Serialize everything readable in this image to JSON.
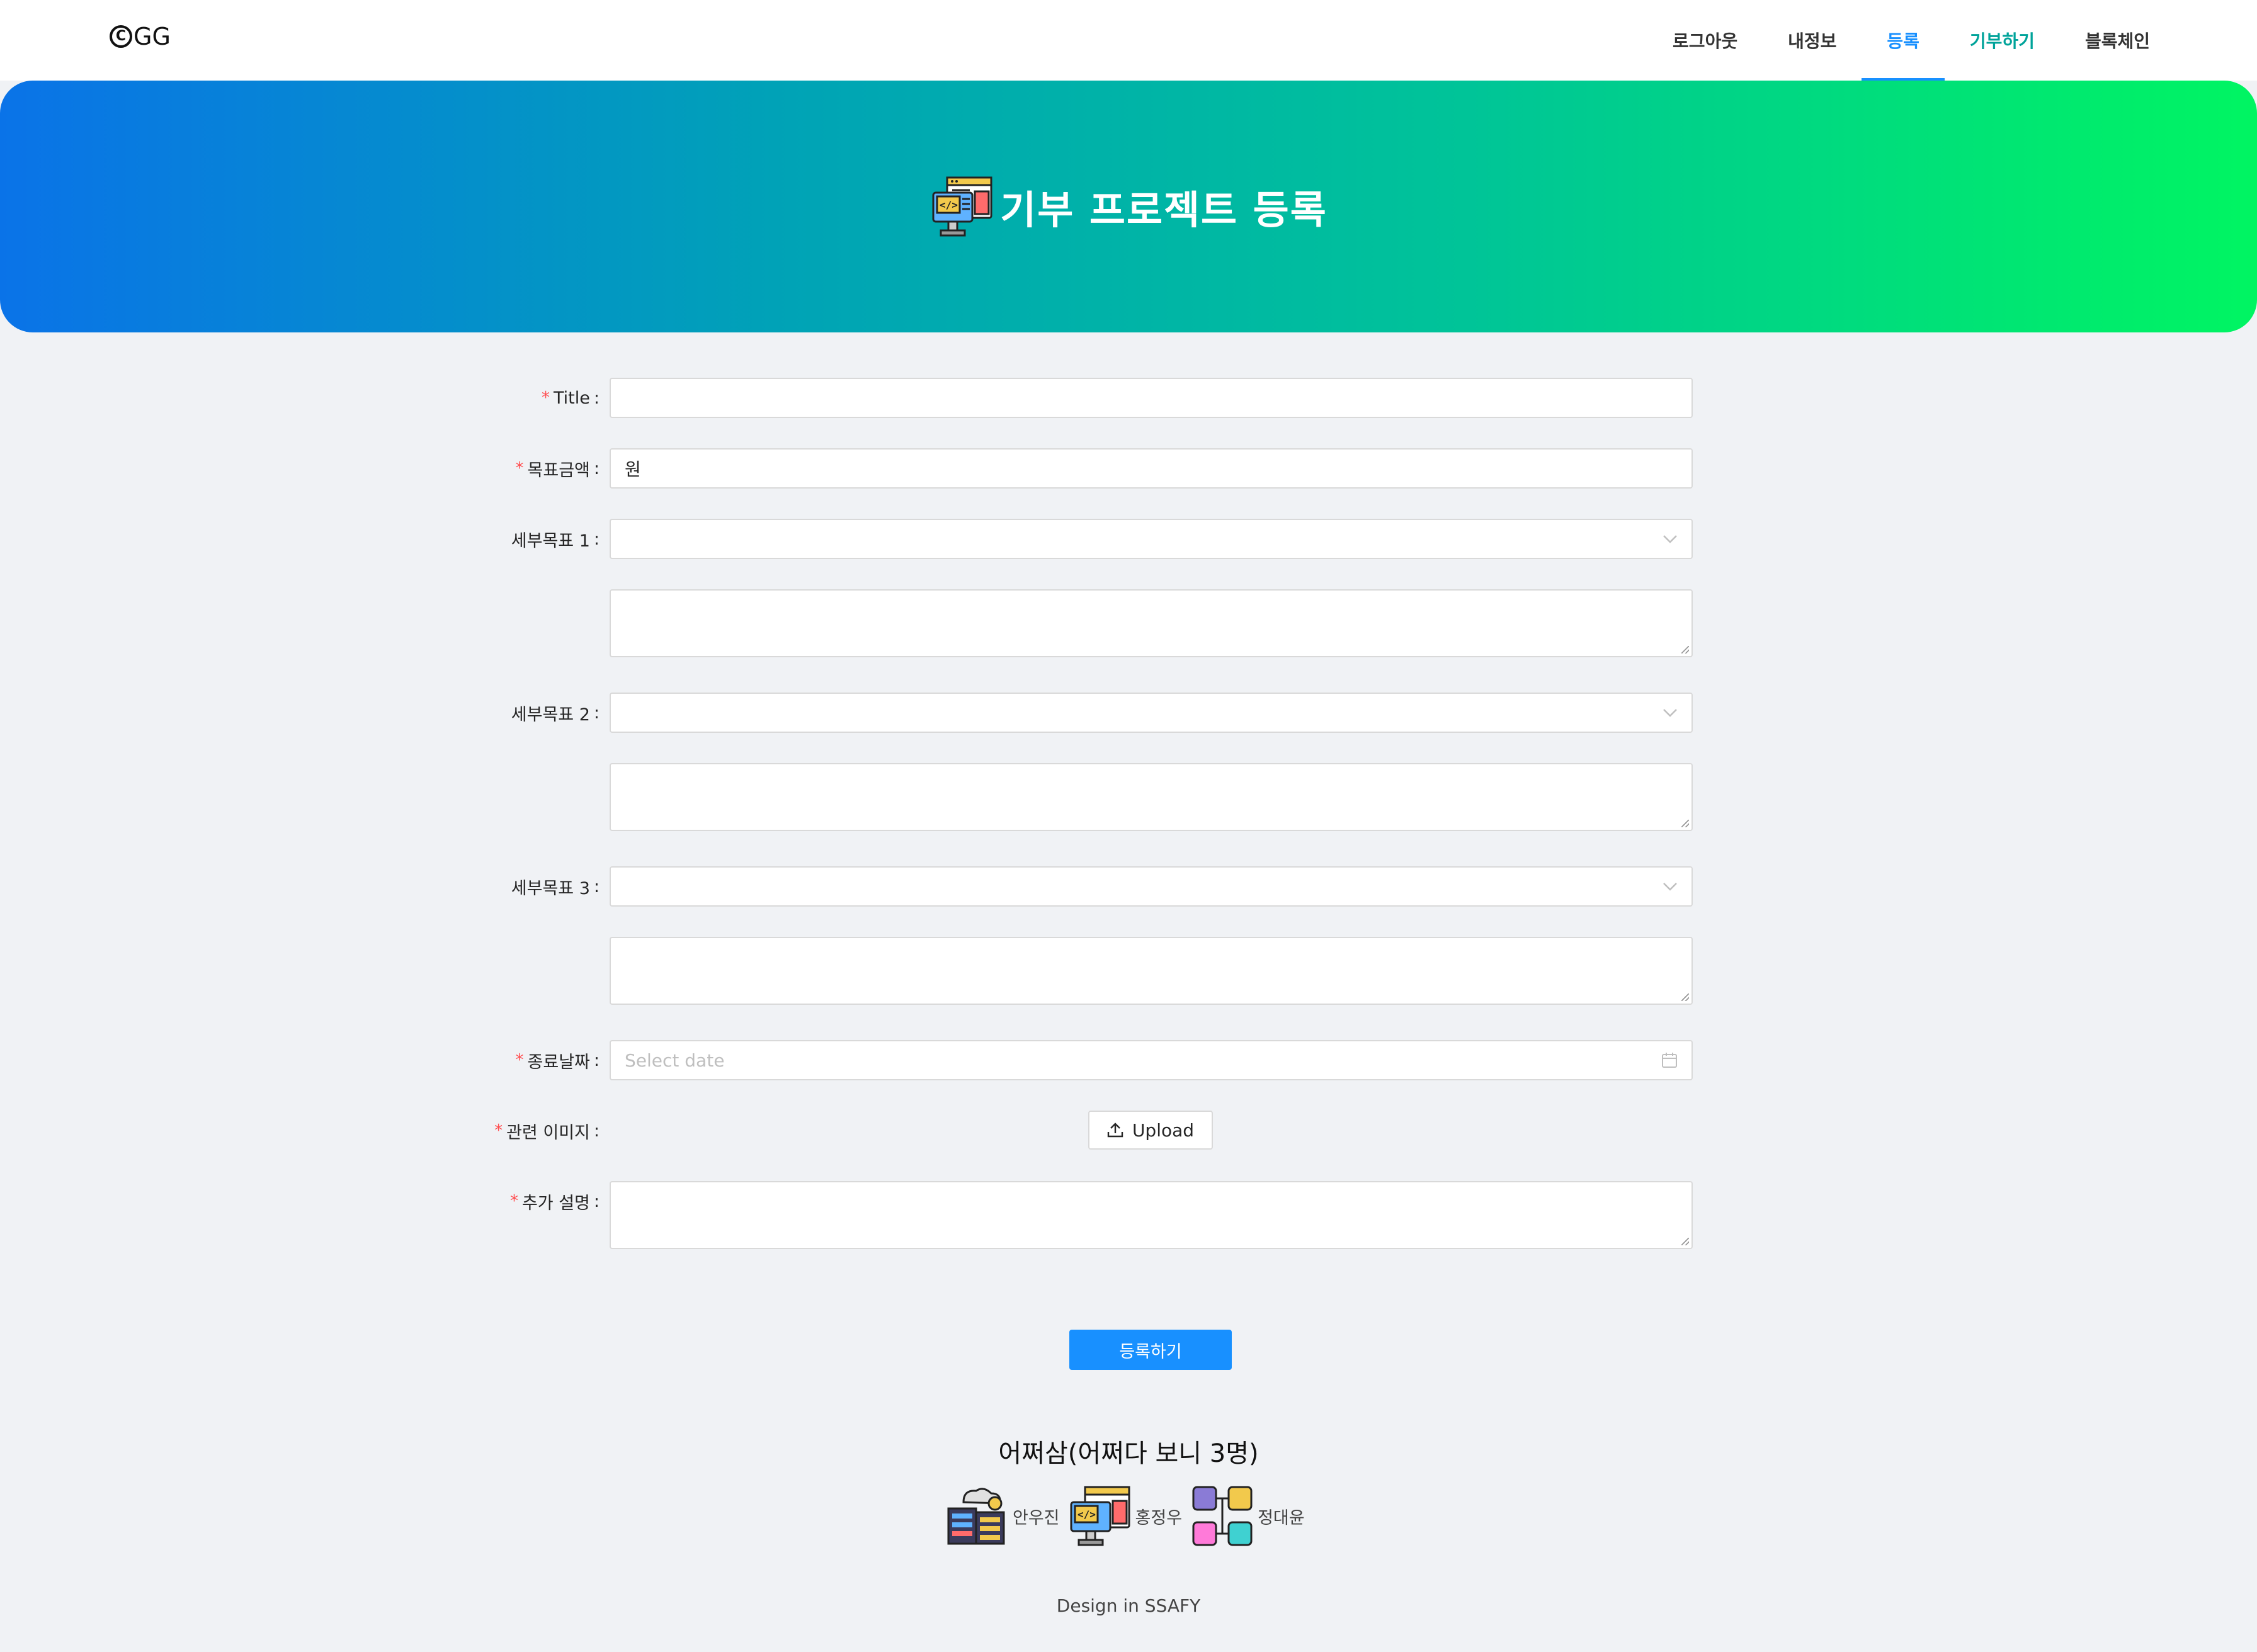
{
  "header": {
    "logo": "GG",
    "nav": [
      {
        "label": "로그아웃"
      },
      {
        "label": "내정보"
      },
      {
        "label": "등록"
      },
      {
        "label": "기부하기"
      },
      {
        "label": "블록체인"
      }
    ],
    "active_index": 2
  },
  "banner": {
    "title": "기부 프로젝트 등록",
    "icon": "code-monitor-icon"
  },
  "form": {
    "title": {
      "label": "Title",
      "required": true,
      "value": ""
    },
    "goal_amount": {
      "label": "목표금액",
      "required": true,
      "prefix": "원",
      "value": ""
    },
    "sub_goal_1": {
      "label": "세부목표 1",
      "required": false,
      "value": "",
      "description": ""
    },
    "sub_goal_2": {
      "label": "세부목표 2",
      "required": false,
      "value": "",
      "description": ""
    },
    "sub_goal_3": {
      "label": "세부목표 3",
      "required": false,
      "value": "",
      "description": ""
    },
    "end_date": {
      "label": "종료날짜",
      "required": true,
      "placeholder": "Select date"
    },
    "image": {
      "label": "관련 이미지",
      "required": true,
      "button": "Upload"
    },
    "extra_description": {
      "label": "추가 설명",
      "required": true,
      "value": ""
    },
    "submit": "등록하기"
  },
  "team": {
    "title": "어쩌삼(어쩌다 보니 3명)",
    "members": [
      {
        "name": "안우진",
        "icon": "cloud-server-icon"
      },
      {
        "name": "홍정우",
        "icon": "code-monitor-icon"
      },
      {
        "name": "정대윤",
        "icon": "network-blocks-icon"
      }
    ]
  },
  "footer": "Design in SSAFY",
  "colors": {
    "accent": "#1890ff",
    "required": "#ff4d4f",
    "gradient_start": "#0a73e8",
    "gradient_end": "#00f562"
  }
}
